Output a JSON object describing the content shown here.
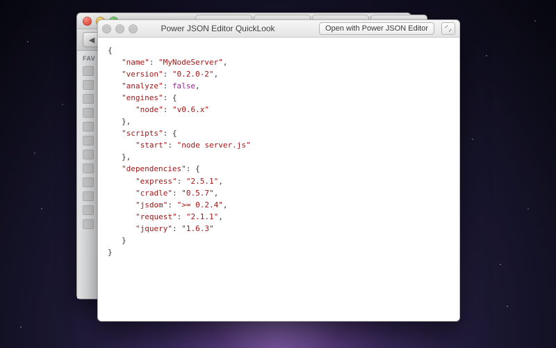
{
  "quicklook": {
    "title": "Power JSON Editor QuickLook",
    "open_button": "Open with Power JSON Editor"
  },
  "background_window": {
    "sidebar_header": "FAV",
    "tabs": [
      "",
      "",
      "",
      ""
    ],
    "nav_back": "◀",
    "nav_fwd": "▶"
  },
  "json_doc": {
    "keys": {
      "name": "\"name\"",
      "version": "\"version\"",
      "analyze": "\"analyze\"",
      "engines": "\"engines\"",
      "node": "\"node\"",
      "scripts": "\"scripts\"",
      "start": "\"start\"",
      "dependencies": "\"dependencies\"",
      "express": "\"express\"",
      "cradle": "\"cradle\"",
      "jsdom": "\"jsdom\"",
      "request": "\"request\"",
      "jquery": "\"jquery\""
    },
    "vals": {
      "name": "\"MyNodeServer\"",
      "version": "\"0.2.0-2\"",
      "analyze": "false",
      "node": "\"v0.6.x\"",
      "start": "\"node server.js\"",
      "express": "\"2.5.1\"",
      "cradle": "\"0.5.7\"",
      "jsdom": "\">= 0.2.4\"",
      "request": "\"2.1.1\"",
      "jquery": "\"1.6.3\""
    }
  }
}
